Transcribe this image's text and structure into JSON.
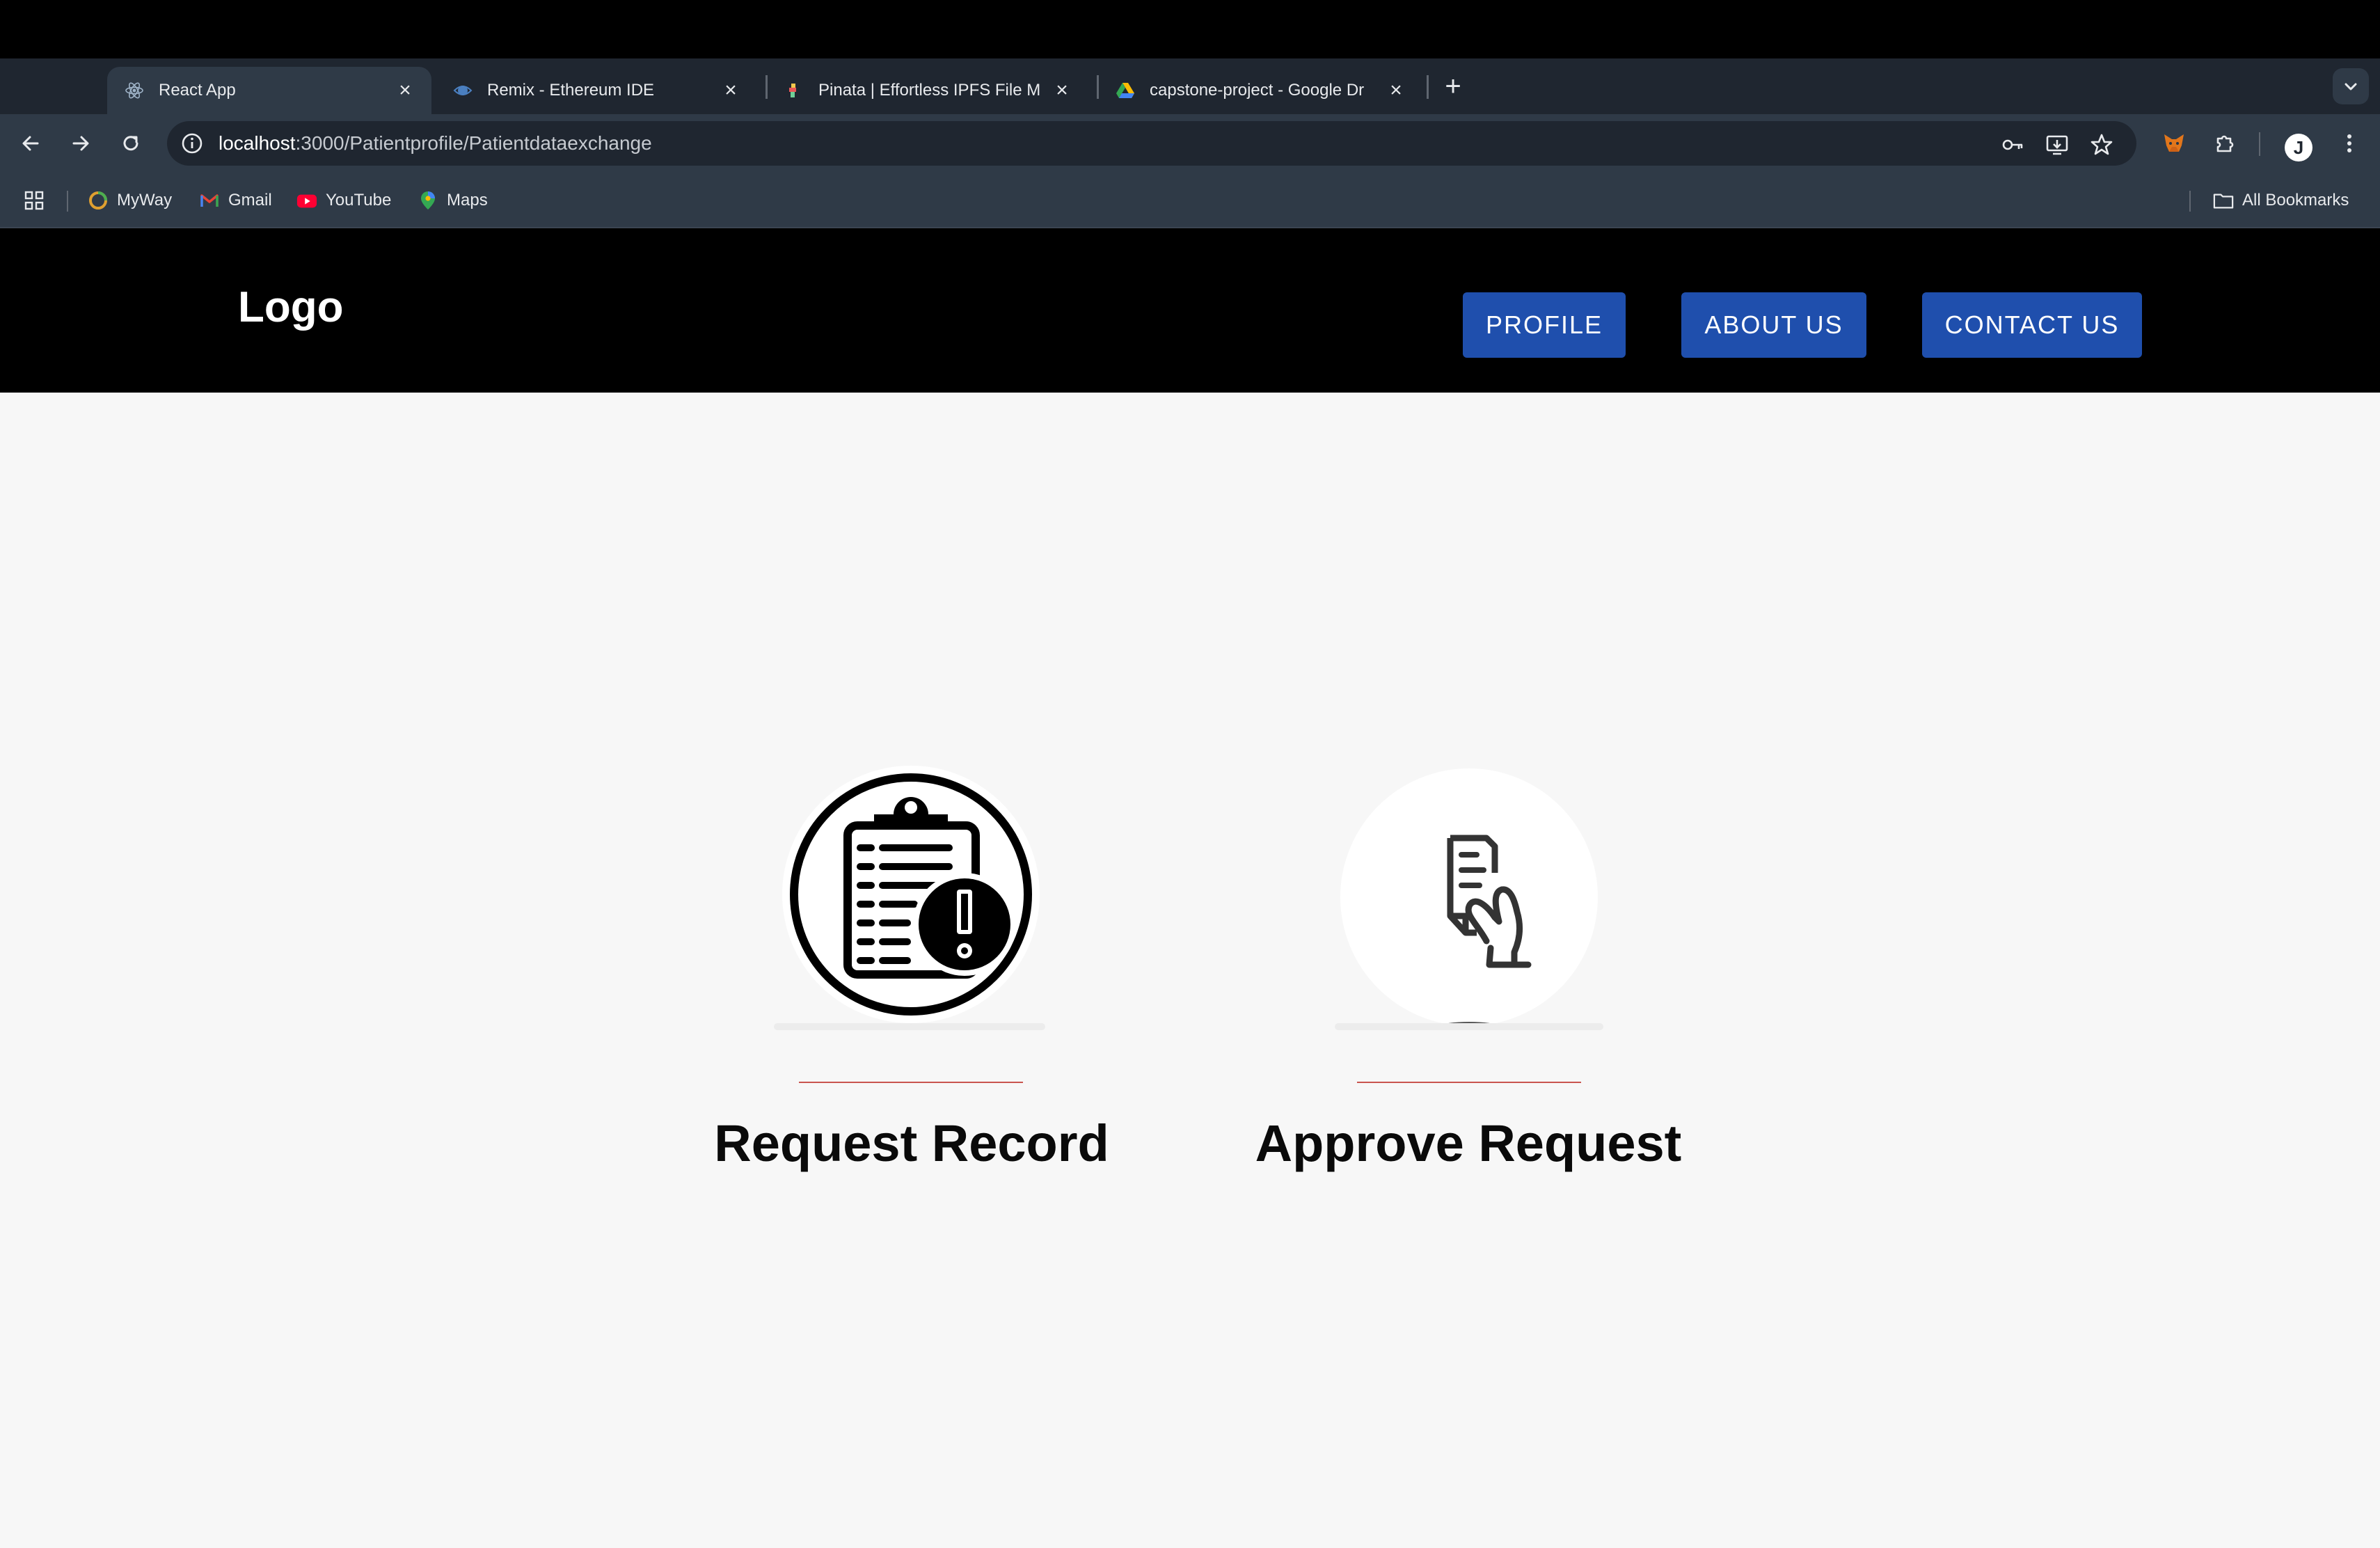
{
  "browser": {
    "tabs": [
      {
        "title": "React App",
        "favicon": "react-icon",
        "active": true
      },
      {
        "title": "Remix - Ethereum IDE",
        "favicon": "remix-icon",
        "active": false
      },
      {
        "title": "Pinata | Effortless IPFS File M",
        "favicon": "pinata-icon",
        "active": false
      },
      {
        "title": "capstone-project - Google Dr",
        "favicon": "google-drive-icon",
        "active": false
      }
    ],
    "new_tab_label": "+",
    "address_bar": {
      "url_host": "localhost",
      "url_rest": ":3000/Patientprofile/Patientdataexchange"
    },
    "bookmarks": [
      {
        "label": "MyWay",
        "icon": "myway-icon"
      },
      {
        "label": "Gmail",
        "icon": "gmail-icon"
      },
      {
        "label": "YouTube",
        "icon": "youtube-icon"
      },
      {
        "label": "Maps",
        "icon": "maps-icon"
      }
    ],
    "all_bookmarks_label": "All Bookmarks",
    "profile_initial": "J"
  },
  "app": {
    "logo": "Logo",
    "nav": [
      {
        "label": "PROFILE"
      },
      {
        "label": "ABOUT US"
      },
      {
        "label": "CONTACT US"
      }
    ],
    "accent_color": "#1f4fad",
    "cards": [
      {
        "title": "Request Record",
        "icon": "clipboard-alert-icon"
      },
      {
        "title": "Approve Request",
        "icon": "hand-document-icon"
      }
    ],
    "divider_color": "#c9554f"
  }
}
